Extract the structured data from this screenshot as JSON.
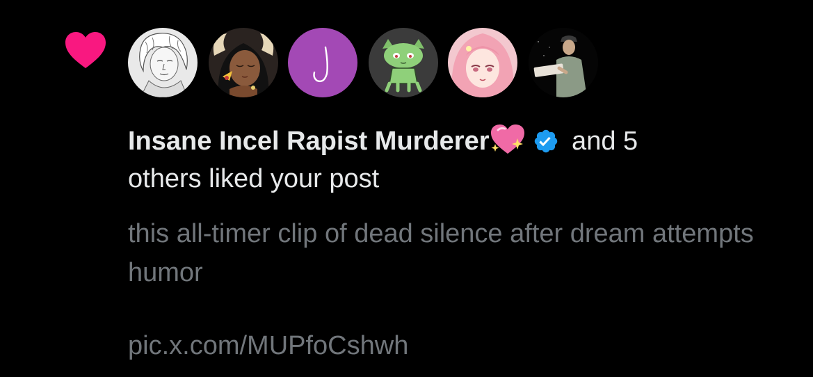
{
  "notification": {
    "type_icon": "heart-icon",
    "accent_color": "#f91880",
    "verified_color": "#1d9bf0",
    "avatars": [
      {
        "name": "avatar-sketch-portrait"
      },
      {
        "name": "avatar-horned-character"
      },
      {
        "name": "avatar-letter-j",
        "letter": "J",
        "color": "#a349b5"
      },
      {
        "name": "avatar-green-cat"
      },
      {
        "name": "avatar-pink-hair-anime"
      },
      {
        "name": "avatar-person-photo"
      }
    ],
    "liker_name": "Insane Incel Rapist Murderer",
    "liker_emoji": "sparkling-heart-icon",
    "verified_icon": "verified-badge-icon",
    "others_text_a": " and 5",
    "others_text_b": "others liked your post",
    "post_text": "this all-timer clip of dead silence after dream attempts humor",
    "post_link": "pic.x.com/MUPfoCshwh"
  }
}
